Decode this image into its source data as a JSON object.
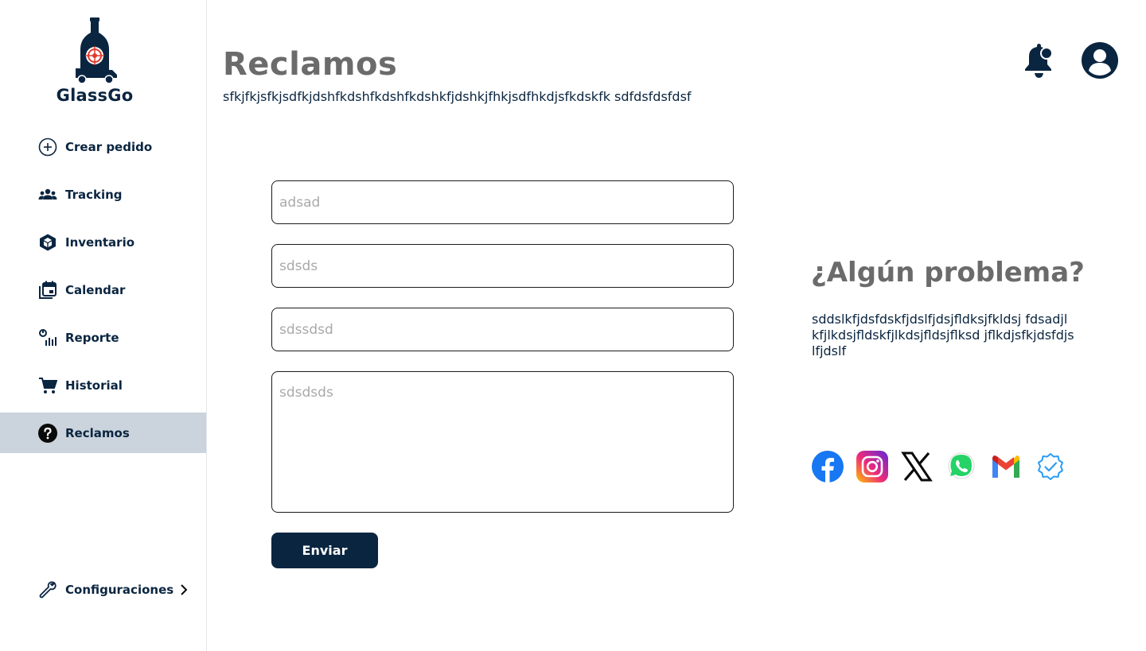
{
  "brand": {
    "name": "GlassGo"
  },
  "sidebar": {
    "items": [
      {
        "label": "Crear pedido",
        "icon": "plus-circle-icon"
      },
      {
        "label": "Tracking",
        "icon": "users-icon"
      },
      {
        "label": "Inventario",
        "icon": "cube-icon"
      },
      {
        "label": "Calendar",
        "icon": "calendar-icon"
      },
      {
        "label": "Reporte",
        "icon": "report-icon"
      },
      {
        "label": "Historial",
        "icon": "cart-icon"
      },
      {
        "label": "Reclamos",
        "icon": "question-icon",
        "active": true
      }
    ],
    "settings": {
      "label": "Configuraciones",
      "icon": "wrench-icon"
    }
  },
  "header": {
    "title": "Reclamos",
    "subtitle": "sfkjfkjsfkjsdfkjdshfkdshfkdshfkdshkfjdshkjfhkjsdfhkdjsfkdskfk sdfdsfdsfdsf"
  },
  "form": {
    "field1_placeholder": "adsad",
    "field2_placeholder": "sdsds",
    "field3_placeholder": "sdssdsd",
    "message_placeholder": "sdsdsds",
    "submit_label": "Enviar"
  },
  "help": {
    "title": "¿Algún problema?",
    "text": "sddslkfjdsfdskfjdslfjdsjfldksjfkldsj fdsadjlkfjlkdsjfldskfjlkdsjfldsjflksd jflkdjsfkjdsfdjslfjdslf"
  },
  "social": [
    "facebook-icon",
    "instagram-icon",
    "x-icon",
    "whatsapp-icon",
    "gmail-icon",
    "verified-icon"
  ],
  "colors": {
    "primary": "#0a2540",
    "active_bg": "#cbd3dc",
    "heading_gray": "#6b6b6b"
  }
}
